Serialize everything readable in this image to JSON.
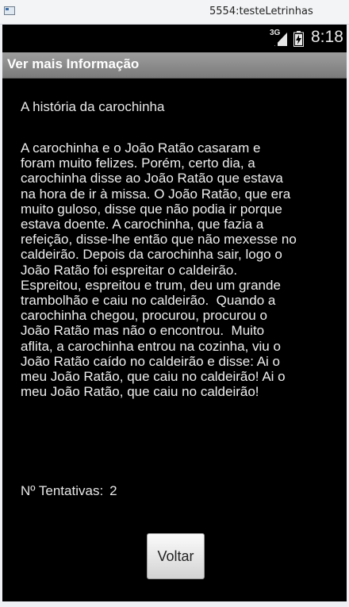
{
  "window": {
    "title": "5554:testeLetrinhas"
  },
  "statusbar": {
    "network_type": "3G",
    "time": "8:18",
    "icons": [
      "signal-icon",
      "battery-icon"
    ]
  },
  "appbar": {
    "title": "Ver mais Informação"
  },
  "content": {
    "heading": "A história da carochinha",
    "story_lines": [
      "A carochinha e o João Ratão casaram e",
      "foram muito felizes. Porém, certo dia, a",
      "carochinha disse ao João Ratão que estava",
      "na hora de ir à missa. O João Ratão, que era",
      "muito guloso, disse que não podia ir porque",
      "estava doente. A carochinha, que fazia a",
      "refeição, disse-lhe então que não mexesse no",
      "caldeirão. Depois da carochinha sair, logo o",
      "João Ratão foi espreitar o caldeirão.",
      "Espreitou, espreitou e trum, deu um grande",
      "trambolhão e caiu no caldeirão.  Quando a",
      "carochinha chegou, procurou, procurou o",
      "João Ratão mas não o encontrou.  Muito",
      "aflita, a carochinha entrou na cozinha, viu o",
      "João Ratão caído no caldeirão e disse: Ai o",
      "meu João Ratão, que caiu no caldeirão! Ai o",
      "meu João Ratão, que caiu no caldeirão!"
    ],
    "attempts_label": "Nº Tentativas:",
    "attempts_value": "2"
  },
  "actions": {
    "back_label": "Voltar"
  },
  "colors": {
    "screen_bg": "#000000",
    "appbar_bg": "#8c8c8c",
    "text": "#eeeeee"
  }
}
